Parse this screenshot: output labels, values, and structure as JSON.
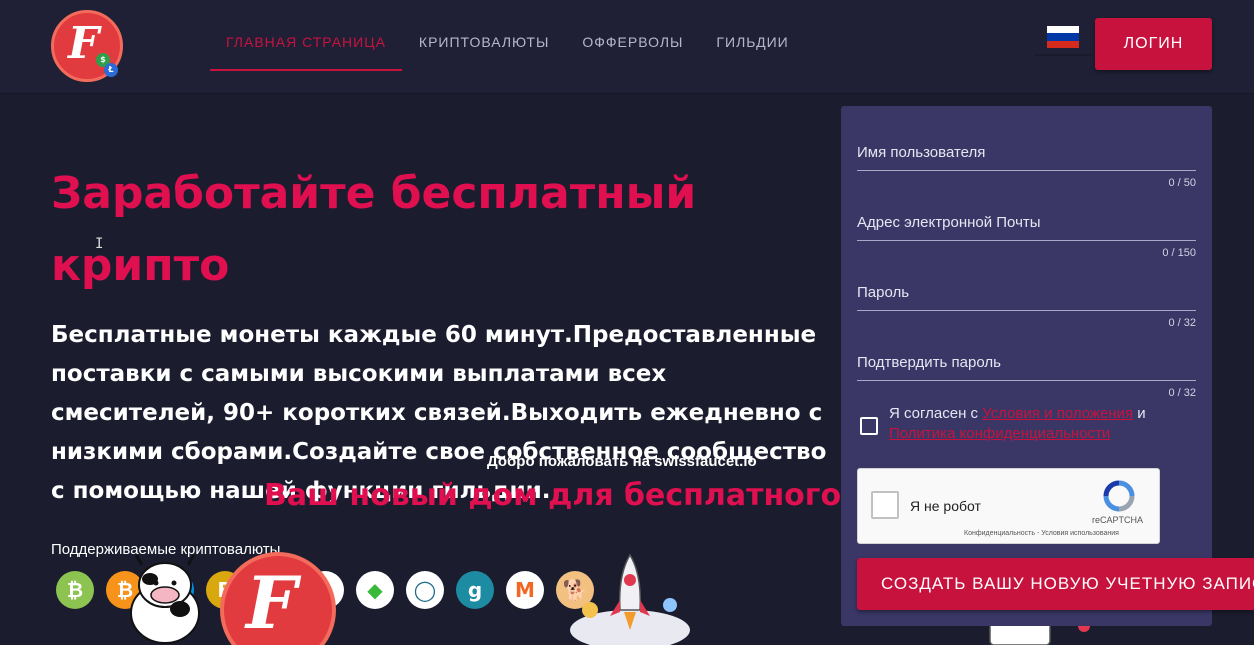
{
  "nav": {
    "items": [
      {
        "label": "ГЛАВНАЯ СТРАНИЦА",
        "active": true
      },
      {
        "label": "КРИПТОВАЛЮТЫ",
        "active": false
      },
      {
        "label": "ОФФЕРВОЛЫ",
        "active": false
      },
      {
        "label": "ГИЛЬДИИ",
        "active": false
      }
    ],
    "login_label": "ЛОГИН"
  },
  "hero": {
    "title": "Заработайте бесплатный крипто",
    "description": "Бесплатные монеты каждые 60 минут.Предоставленные поставки с самыми высокими выплатами всех смесителей, 90+ коротких связей.Выходить ежедневно с низкими сборами.Создайте свое собственное сообщество с помощью нашей функции гильдии.",
    "overlay_welcome": "Добро пожаловать на swissfaucet.io",
    "overlay_home": "Ваш новый дом для бесплатного",
    "supported_label": "Поддерживаемые криптовалюты"
  },
  "coins": [
    {
      "name": "bitcoin-cash-icon",
      "glyph": "₿",
      "color": "#8dc351"
    },
    {
      "name": "bitcoin-icon",
      "glyph": "₿",
      "color": "#f7931a"
    },
    {
      "name": "dash-icon",
      "glyph": "D",
      "color": "#008de4"
    },
    {
      "name": "binance-icon",
      "glyph": "B",
      "color": "#d9a80f"
    },
    {
      "name": "dogecoin-icon",
      "glyph": "Ð",
      "color": "#c2a633"
    },
    {
      "name": "ethereum-icon",
      "glyph": "◆",
      "color": "#ffffff"
    },
    {
      "name": "ethereum-classic-icon",
      "glyph": "◆",
      "color": "#3ab83a"
    },
    {
      "name": "lisk-icon",
      "glyph": "◯",
      "color": "#ffffff"
    },
    {
      "name": "gridcoin-icon",
      "glyph": "g",
      "color": "#1d8ca3"
    },
    {
      "name": "monero-icon",
      "glyph": "M",
      "color": "#ffffff"
    },
    {
      "name": "shiba-icon",
      "glyph": "🐕",
      "color": "#f2c182"
    }
  ],
  "form": {
    "username_label": "Имя пользователя",
    "username_count": "0 / 50",
    "email_label": "Адрес электронной Почты",
    "email_count": "0 / 150",
    "password_label": "Пароль",
    "password_count": "0 / 32",
    "confirm_label": "Подтвердить пароль",
    "confirm_count": "0 / 32",
    "agree_prefix": "Я согласен с ",
    "terms_link": "Условия и положения",
    "agree_and": " и ",
    "privacy_link": "Политика конфиденциальности",
    "recaptcha_label": "Я не робот",
    "recaptcha_brand": "reCAPTCHA",
    "recaptcha_privacy": "Конфиденциальность - Условия использования",
    "create_label": "СОЗДАТЬ ВАШУ НОВУЮ УЧЕТНУЮ ЗАПИСЬ"
  },
  "colors": {
    "accent": "#c8123e",
    "title": "#e01050",
    "panel": "#3a3766",
    "bg": "#1b1c2e"
  }
}
